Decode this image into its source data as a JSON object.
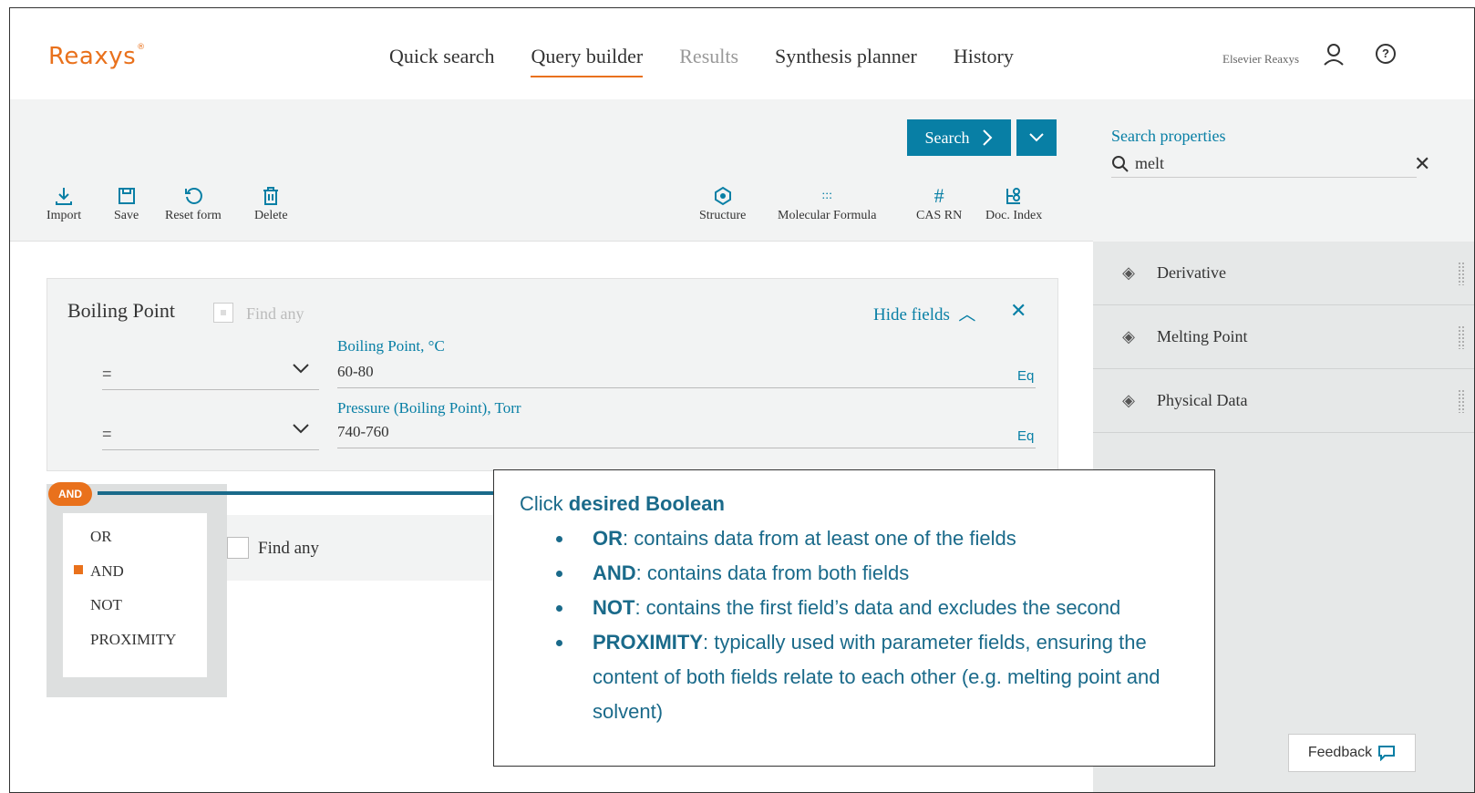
{
  "header": {
    "logo": "Reaxys",
    "nav": [
      {
        "label": "Quick search"
      },
      {
        "label": "Query builder"
      },
      {
        "label": "Results"
      },
      {
        "label": "Synthesis planner"
      },
      {
        "label": "History"
      }
    ],
    "user": "Elsevier Reaxys"
  },
  "toolbar": {
    "search_label": "Search",
    "left_tools": [
      {
        "label": "Import",
        "icon": "download-icon"
      },
      {
        "label": "Save",
        "icon": "save-icon"
      },
      {
        "label": "Reset form",
        "icon": "reset-icon"
      },
      {
        "label": "Delete",
        "icon": "trash-icon"
      }
    ],
    "right_tools": [
      {
        "label": "Structure",
        "icon": "structure-icon"
      },
      {
        "label": "Molecular Formula",
        "icon": "formula-icon"
      },
      {
        "label": "CAS RN",
        "icon": "hash-icon"
      },
      {
        "label": "Doc. Index",
        "icon": "doc-index-icon"
      }
    ]
  },
  "sidepanel": {
    "title": "Search properties",
    "search_value": "melt",
    "items": [
      {
        "label": "Derivative"
      },
      {
        "label": "Melting Point"
      },
      {
        "label": "Physical Data"
      }
    ]
  },
  "card": {
    "title": "Boiling Point",
    "find_any": "Find any",
    "hide_fields": "Hide fields",
    "fields": [
      {
        "operator": "=",
        "label": "Boiling Point, °C",
        "value": "60-80"
      },
      {
        "operator": "=",
        "label": "Pressure (Boiling Point), Torr",
        "value": "740-760"
      }
    ]
  },
  "row2": {
    "find_any": "Find any"
  },
  "boolean": {
    "badge": "AND",
    "options": [
      {
        "label": "OR"
      },
      {
        "label": "AND"
      },
      {
        "label": "NOT"
      },
      {
        "label": "PROXIMITY"
      }
    ],
    "selected": "AND"
  },
  "callout": {
    "intro_prefix": "Click ",
    "intro_bold": "desired Boolean",
    "items": [
      {
        "term": "OR",
        "text": ":  contains data from at least one of the fields"
      },
      {
        "term": "AND",
        "text": ":  contains data from both fields"
      },
      {
        "term": "NOT",
        "text": ":  contains the first field’s data and excludes the second"
      },
      {
        "term": "PROXIMITY",
        "text": ":  typically used with parameter fields, ensuring the content of both fields relate to each other (e.g. melting point and solvent)"
      }
    ]
  },
  "feedback": "Feedback",
  "colors": {
    "brand_orange": "#e9711c",
    "accent_blue": "#087fa5",
    "callout_blue": "#1a6a8a"
  }
}
